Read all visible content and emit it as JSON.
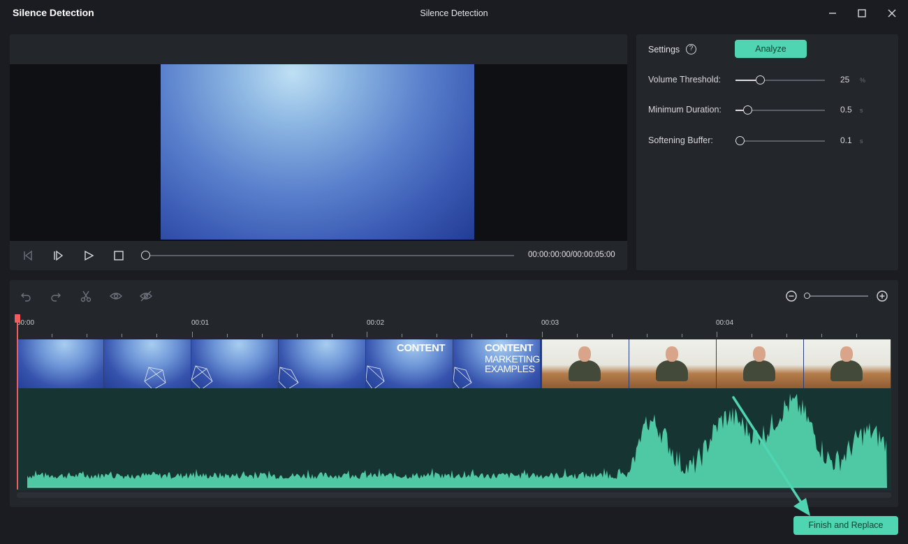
{
  "window": {
    "app_title": "Silence Detection",
    "title": "Silence Detection",
    "controls": [
      "minimize-icon",
      "maximize-icon",
      "close-icon"
    ]
  },
  "preview": {
    "timecode": "00:00:00:00/00:00:05:00",
    "progress": 0,
    "controls": [
      "step-back-icon",
      "step-forward-icon",
      "play-icon",
      "stop-icon"
    ]
  },
  "settings": {
    "label": "Settings",
    "help_icon": "?",
    "analyze_label": "Analyze",
    "params": [
      {
        "label": "Volume Threshold:",
        "value": "25",
        "unit": "%",
        "level": 0.27
      },
      {
        "label": "Minimum Duration:",
        "value": "0.5",
        "unit": "s",
        "level": 0.13
      },
      {
        "label": "Softening Buffer:",
        "value": "0.1",
        "unit": "s",
        "level": 0.05
      }
    ]
  },
  "timeline": {
    "tools": [
      "undo-icon",
      "redo-icon",
      "scissors-icon",
      "eye-icon",
      "eye-off-icon"
    ],
    "ruler_labels": [
      "00:00",
      "00:01",
      "00:02",
      "00:03",
      "00:04"
    ],
    "thumb_texts": {
      "content_single": "CONTENT",
      "content_block": [
        "CONTENT",
        "MARKETING",
        "EXAMPLES"
      ]
    },
    "zoom_level": 0
  },
  "colors": {
    "accent": "#4fd5b1",
    "playhead": "#f25c5c",
    "waveform": "#4fc9a4",
    "audio_bg": "#163432"
  },
  "finish_label": "Finish and Replace"
}
